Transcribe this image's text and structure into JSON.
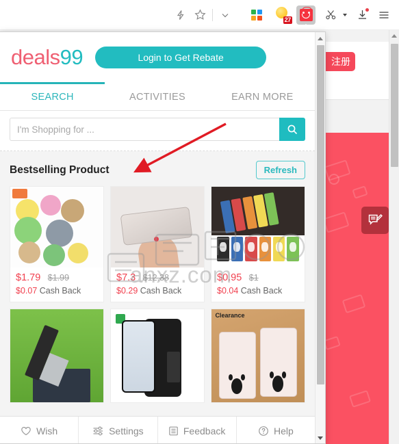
{
  "browser": {
    "toolbar_icons": [
      {
        "name": "flash-icon",
        "glyph": "lightning"
      },
      {
        "name": "favorite-star-icon",
        "glyph": "star"
      },
      {
        "name": "chevron-down-icon",
        "glyph": "chevron"
      },
      {
        "name": "apps-grid-icon",
        "glyph": "grid"
      },
      {
        "name": "weather-sun-icon",
        "glyph": "sun"
      },
      {
        "name": "deals-extension-icon",
        "glyph": "shopping-bag"
      },
      {
        "name": "scissors-clip-icon",
        "glyph": "scissors"
      },
      {
        "name": "downloads-icon",
        "glyph": "download"
      },
      {
        "name": "browser-menu-icon",
        "glyph": "hamburger"
      }
    ],
    "notification_badge": "27"
  },
  "background_page": {
    "register_button": "注册"
  },
  "popup": {
    "logo": {
      "part1": "deals",
      "part2": "99"
    },
    "login_button": "Login to Get Rebate",
    "tabs": [
      {
        "label": "SEARCH",
        "active": true
      },
      {
        "label": "ACTIVITIES",
        "active": false
      },
      {
        "label": "EARN MORE",
        "active": false
      }
    ],
    "search": {
      "placeholder": "I'm Shopping for ...",
      "value": "",
      "button_icon": "search-icon"
    },
    "section": {
      "title": "Bestselling Product",
      "refresh_label": "Refresh"
    },
    "products": [
      {
        "id": "plush-toys",
        "price": "$1.79",
        "old_price": "$1.99",
        "cash_back_amount": "$0.07",
        "cash_back_label": "Cash Back"
      },
      {
        "id": "leather-wallet",
        "price": "$7.3",
        "old_price": "$12.38",
        "cash_back_amount": "$0.29",
        "cash_back_label": "Cash Back"
      },
      {
        "id": "cartoon-luggage-tags",
        "price": "$0.95",
        "old_price": "$1",
        "cash_back_amount": "$0.04",
        "cash_back_label": "Cash Back"
      },
      {
        "id": "folding-shovel",
        "price": "",
        "old_price": "",
        "cash_back_amount": "",
        "cash_back_label": ""
      },
      {
        "id": "card-slot-phone-case",
        "price": "",
        "old_price": "",
        "cash_back_amount": "",
        "cash_back_label": ""
      },
      {
        "id": "mickey-minnie-phone-case",
        "price": "",
        "old_price": "",
        "cash_back_amount": "",
        "cash_back_label": "",
        "overlay_label": "Clearance"
      }
    ],
    "bottom_nav": [
      {
        "label": "Wish",
        "icon": "heart-icon"
      },
      {
        "label": "Settings",
        "icon": "sliders-icon"
      },
      {
        "label": "Feedback",
        "icon": "document-icon"
      },
      {
        "label": "Help",
        "icon": "question-circle-icon"
      }
    ]
  },
  "watermark": {
    "text_cn": "安下载",
    "text_en": "anxz.com"
  },
  "colors": {
    "brand_teal": "#22bcc0",
    "brand_pink": "#ef5f72",
    "price_red": "#f1414f",
    "annotation_red": "#e01b24",
    "extension_red": "#f5333f"
  }
}
